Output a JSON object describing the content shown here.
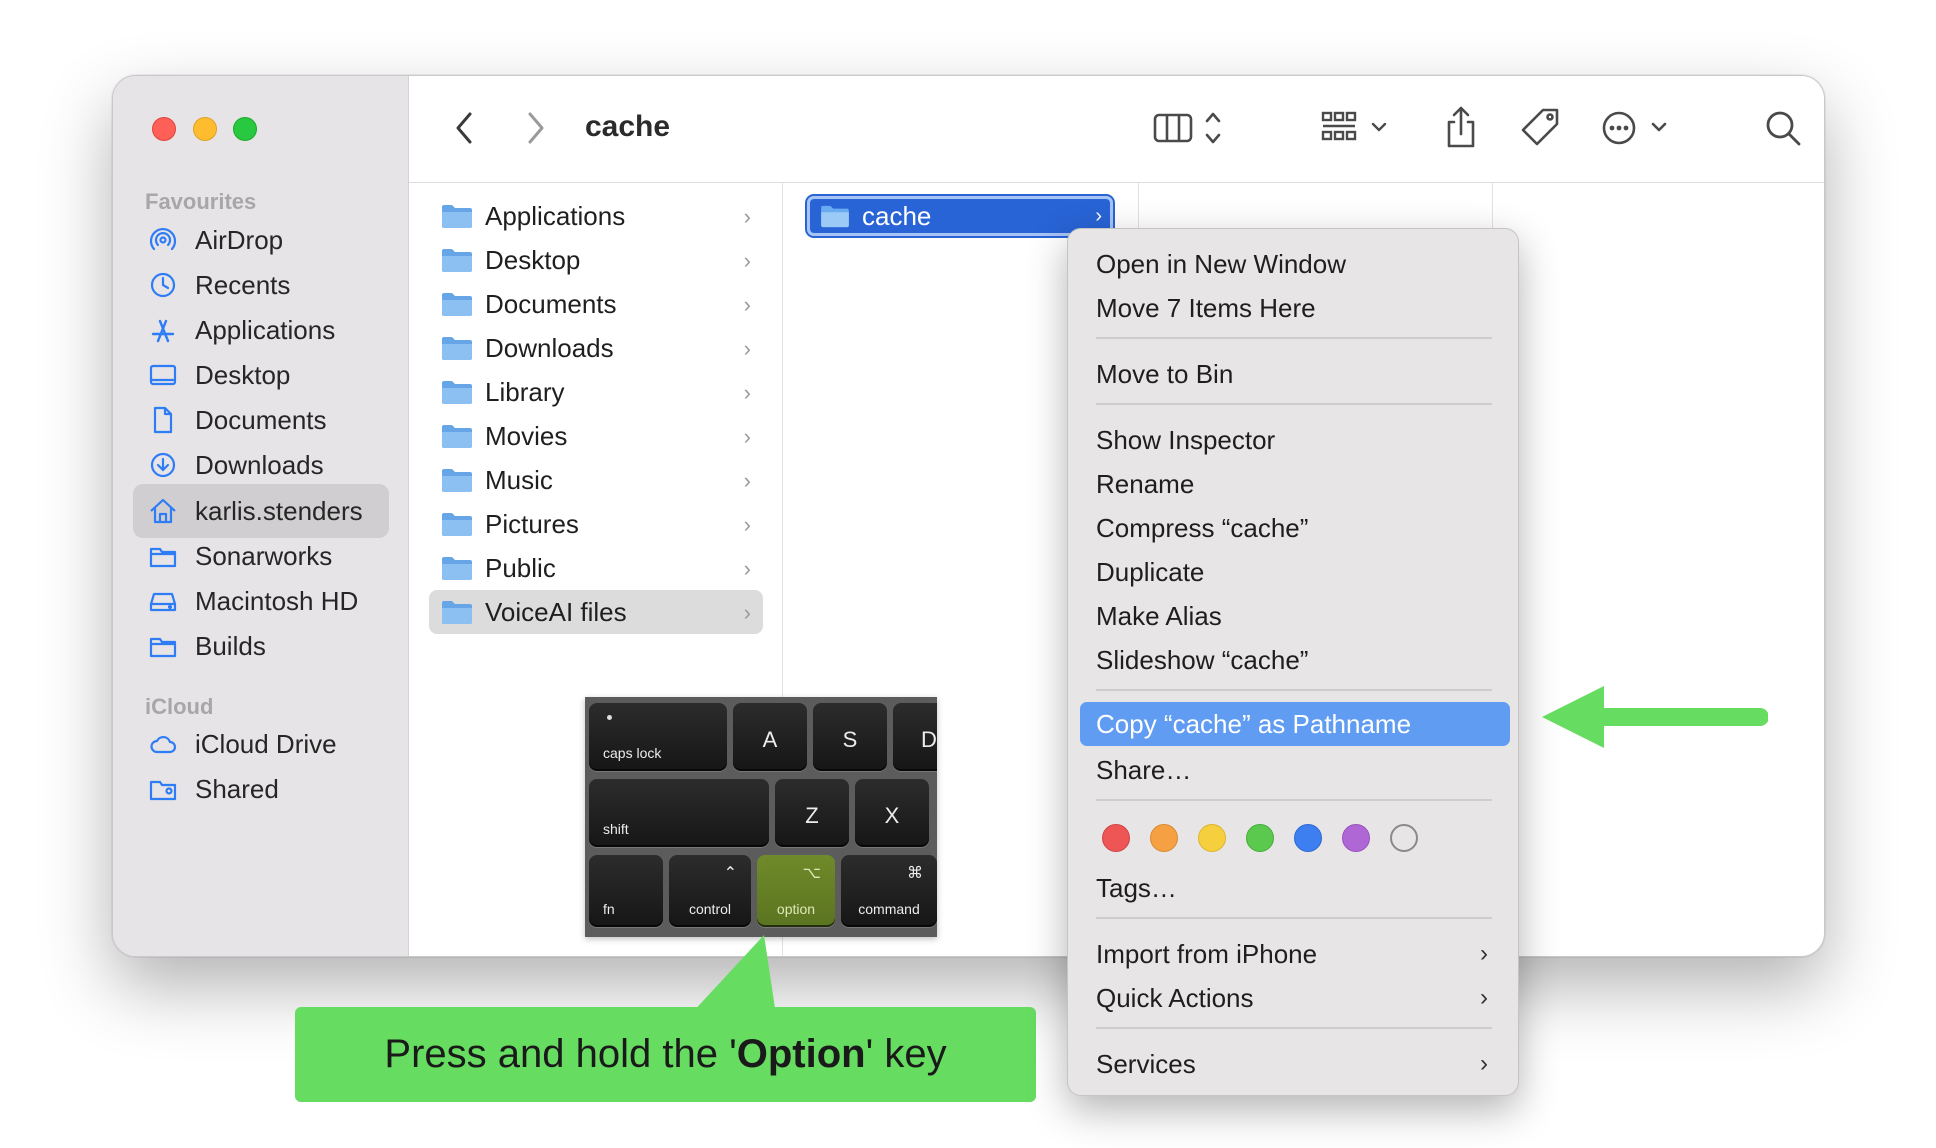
{
  "window": {
    "title": "cache",
    "traffic_lights": {
      "close": "#fe5f57",
      "minimize": "#febc2e",
      "zoom": "#28c840"
    }
  },
  "toolbar": {
    "back_icon": "chevron-left-icon",
    "forward_icon": "chevron-right-icon",
    "view_icon": "columns-view-icon",
    "group_icon": "grid-group-icon",
    "share_icon": "share-icon",
    "tag_icon": "tag-icon",
    "more_icon": "ellipsis-circle-icon",
    "search_icon": "search-icon"
  },
  "sidebar": {
    "favourites_header": "Favourites",
    "favourites": [
      {
        "label": "AirDrop",
        "icon": "airdrop-icon"
      },
      {
        "label": "Recents",
        "icon": "clock-icon"
      },
      {
        "label": "Applications",
        "icon": "applications-icon"
      },
      {
        "label": "Desktop",
        "icon": "desktop-icon"
      },
      {
        "label": "Documents",
        "icon": "document-icon"
      },
      {
        "label": "Downloads",
        "icon": "download-icon"
      },
      {
        "label": "karlis.stenders",
        "icon": "home-icon",
        "selected": true
      },
      {
        "label": "Sonarworks",
        "icon": "folder-icon"
      },
      {
        "label": "Macintosh HD",
        "icon": "disk-icon"
      },
      {
        "label": "Builds",
        "icon": "folder-icon"
      }
    ],
    "icloud_header": "iCloud",
    "icloud": [
      {
        "label": "iCloud Drive",
        "icon": "cloud-icon"
      },
      {
        "label": "Shared",
        "icon": "shared-folder-icon"
      }
    ]
  },
  "column1": {
    "items": [
      {
        "label": "Applications"
      },
      {
        "label": "Desktop"
      },
      {
        "label": "Documents"
      },
      {
        "label": "Downloads"
      },
      {
        "label": "Library"
      },
      {
        "label": "Movies"
      },
      {
        "label": "Music"
      },
      {
        "label": "Pictures"
      },
      {
        "label": "Public"
      },
      {
        "label": "VoiceAI files",
        "highlighted": true
      }
    ]
  },
  "column2": {
    "selected_item": "cache"
  },
  "keyboard": {
    "keys": {
      "caps": "caps lock",
      "a": "A",
      "s": "S",
      "d": "D",
      "shift": "shift",
      "z": "Z",
      "x": "X",
      "fn": "fn",
      "control": "control",
      "control_sym": "⌃",
      "option": "option",
      "option_sym": "⌥",
      "command": "command",
      "command_sym": "⌘"
    },
    "highlighted_key": "option",
    "highlight_color": "#6f8a2a"
  },
  "callout": {
    "prefix": "Press and hold the '",
    "bold": "Option",
    "suffix": "' key",
    "color": "#66dc60"
  },
  "context_menu": {
    "open_new_window": "Open in New Window",
    "move_items_here": "Move 7 Items Here",
    "move_to_bin": "Move to Bin",
    "show_inspector": "Show Inspector",
    "rename": "Rename",
    "compress": "Compress “cache”",
    "duplicate": "Duplicate",
    "make_alias": "Make Alias",
    "slideshow": "Slideshow “cache”",
    "copy_pathname": "Copy “cache” as Pathname",
    "share": "Share…",
    "tag_colors": [
      "#ee5555",
      "#f4a043",
      "#f6cf3e",
      "#5ac94e",
      "#3d7ef0",
      "#b067d6",
      "#ffffff"
    ],
    "tags": "Tags…",
    "import_iphone": "Import from iPhone",
    "quick_actions": "Quick Actions",
    "services": "Services",
    "submenu_glyph": "›"
  },
  "annotation": {
    "arrow_color": "#66dc60"
  },
  "glyphs": {
    "chevron": "›"
  }
}
